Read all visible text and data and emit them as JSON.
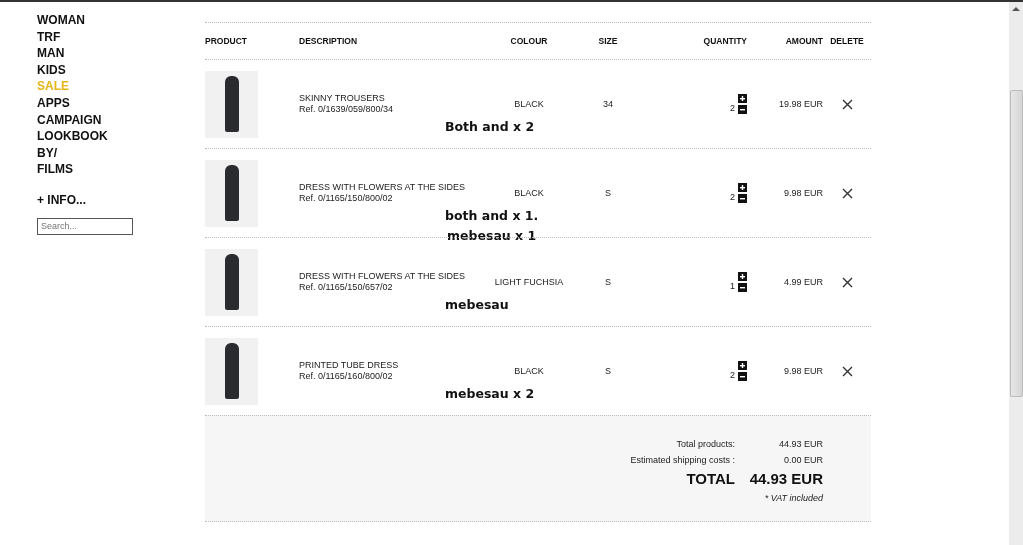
{
  "nav": {
    "items": [
      {
        "label": "WOMAN",
        "selected": false
      },
      {
        "label": "TRF",
        "selected": false
      },
      {
        "label": "MAN",
        "selected": false
      },
      {
        "label": "KIDS",
        "selected": false
      },
      {
        "label": "SALE",
        "selected": true
      },
      {
        "label": "APPS",
        "selected": false
      },
      {
        "label": "CAMPAIGN",
        "selected": false
      },
      {
        "label": "LOOKBOOK",
        "selected": false
      },
      {
        "label": "BY/",
        "selected": false
      },
      {
        "label": "FILMS",
        "selected": false
      }
    ],
    "info": "+ INFO...",
    "search": {
      "placeholder": "Search..."
    }
  },
  "basket": {
    "columns": [
      "PRODUCT",
      "DESCRIPTION",
      "COLOUR",
      "SIZE",
      "QUANTITY",
      "AMOUNT",
      "DELETE"
    ],
    "rows": [
      {
        "name": "SKINNY TROUSERS",
        "ref": "Ref. 0/1639/059/800/34",
        "colour": "BLACK",
        "size": "34",
        "quantity": "2",
        "amount": "19.98 EUR",
        "note": [
          "Both and x 2"
        ]
      },
      {
        "name": "DRESS WITH FLOWERS AT THE SIDES",
        "ref": "Ref. 0/1165/150/800/02",
        "colour": "BLACK",
        "size": "S",
        "quantity": "2",
        "amount": "9.98 EUR",
        "note": [
          "both and x 1.",
          "mebesau x 1"
        ]
      },
      {
        "name": "DRESS WITH FLOWERS AT THE SIDES",
        "ref": "Ref. 0/1165/150/657/02",
        "colour": "LIGHT FUCHSIA",
        "size": "S",
        "quantity": "1",
        "amount": "4.99 EUR",
        "note": [
          "mebesau"
        ]
      },
      {
        "name": "PRINTED TUBE DRESS",
        "ref": "Ref. 0/1165/160/800/02",
        "colour": "BLACK",
        "size": "S",
        "quantity": "2",
        "amount": "9.98 EUR",
        "note": [
          "mebesau x 2"
        ]
      }
    ],
    "summary": [
      {
        "label": "Total products:",
        "value": "44.93 EUR",
        "kind": "line"
      },
      {
        "label": "Estimated shipping costs :",
        "value": "0.00 EUR",
        "kind": "line"
      },
      {
        "label": "TOTAL",
        "value": "44.93 EUR",
        "kind": "total"
      }
    ],
    "vat_note": "* VAT included"
  }
}
